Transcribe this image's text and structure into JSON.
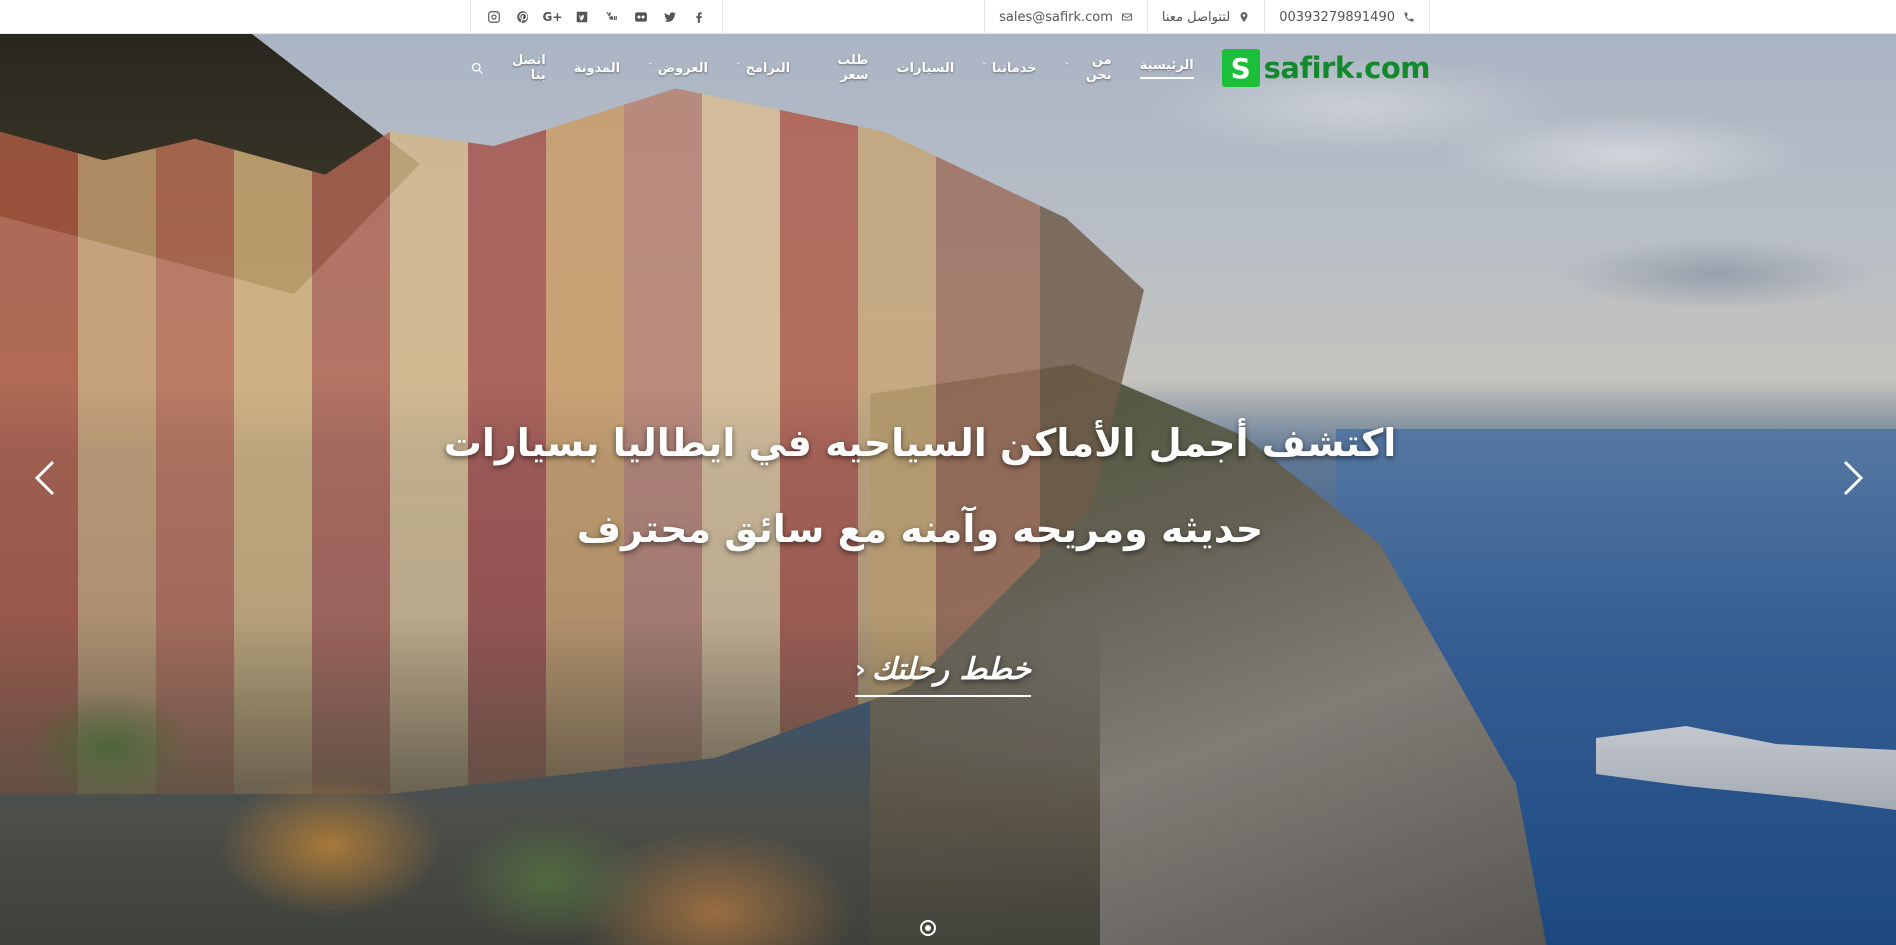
{
  "topbar": {
    "social": [
      {
        "name": "instagram-icon"
      },
      {
        "name": "pinterest-icon"
      },
      {
        "name": "google-plus-icon",
        "text": "G+"
      },
      {
        "name": "vimeo-icon"
      },
      {
        "name": "youtube-icon"
      },
      {
        "name": "flickr-icon"
      },
      {
        "name": "twitter-icon"
      },
      {
        "name": "facebook-icon"
      }
    ],
    "email": "sales@safirk.com",
    "contact_label": "لتتواصل معنا",
    "phone": "00393279891490"
  },
  "nav": {
    "logo_letter": "S",
    "logo_text": "safirk.com",
    "items": [
      {
        "label": "الرئيسية",
        "active": true,
        "dropdown": false
      },
      {
        "label": "من نحن",
        "dropdown": true
      },
      {
        "label": "خدماتنا",
        "dropdown": true
      },
      {
        "label": "السيارات",
        "dropdown": false
      },
      {
        "label": "طلب سعر",
        "dropdown": false
      },
      {
        "label": "البرامج",
        "dropdown": true
      },
      {
        "label": "العروض",
        "dropdown": true
      },
      {
        "label": "المدونة",
        "dropdown": false
      },
      {
        "label": "اتصل بنا",
        "dropdown": false
      }
    ]
  },
  "hero": {
    "line1": "اكتشف أجمل الأماكن السياحيه في ايطاليا بسيارات",
    "line2": "حديثه ومريحه وآمنه مع سائق محترف",
    "cta_label": "خطط رحلتك",
    "slides_count": 1,
    "active_slide": 0
  },
  "colors": {
    "brand_green": "#1bbf3a",
    "logo_text": "#14882c"
  }
}
